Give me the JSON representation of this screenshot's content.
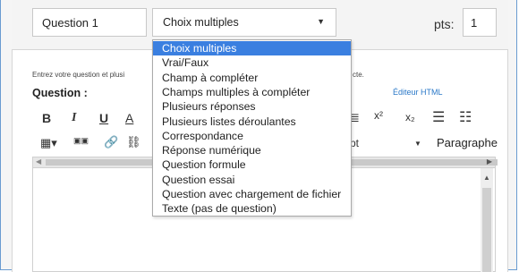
{
  "question_header": {
    "name_value": "Question 1",
    "type_selected": "Choix multiples",
    "pts_label": "pts:",
    "pts_value": "1"
  },
  "dropdown": {
    "options": [
      "Choix multiples",
      "Vrai/Faux",
      "Champ à compléter",
      "Champs multiples à compléter",
      "Plusieurs réponses",
      "Plusieurs listes déroulantes",
      "Correspondance",
      "Réponse numérique",
      "Question formule",
      "Question essai",
      "Question avec chargement de fichier",
      "Texte (pas de question)"
    ],
    "selected_index": 0
  },
  "editor": {
    "instructions": "Entrez votre question et plusi",
    "instructions_tail": "cte.",
    "question_label": "Question :",
    "html_editor_link": "Éditeur HTML",
    "font_fragment": "pt",
    "paragraph_label": "Paragraphe"
  },
  "toolbar": {
    "bold": "B",
    "italic": "I",
    "underline": "U",
    "text_color": "A",
    "superscript": "x²",
    "subscript": "x₂"
  },
  "colors": {
    "accent": "#3a7fe0",
    "frame_border": "#6a9bd1",
    "link": "#2a78c8"
  }
}
